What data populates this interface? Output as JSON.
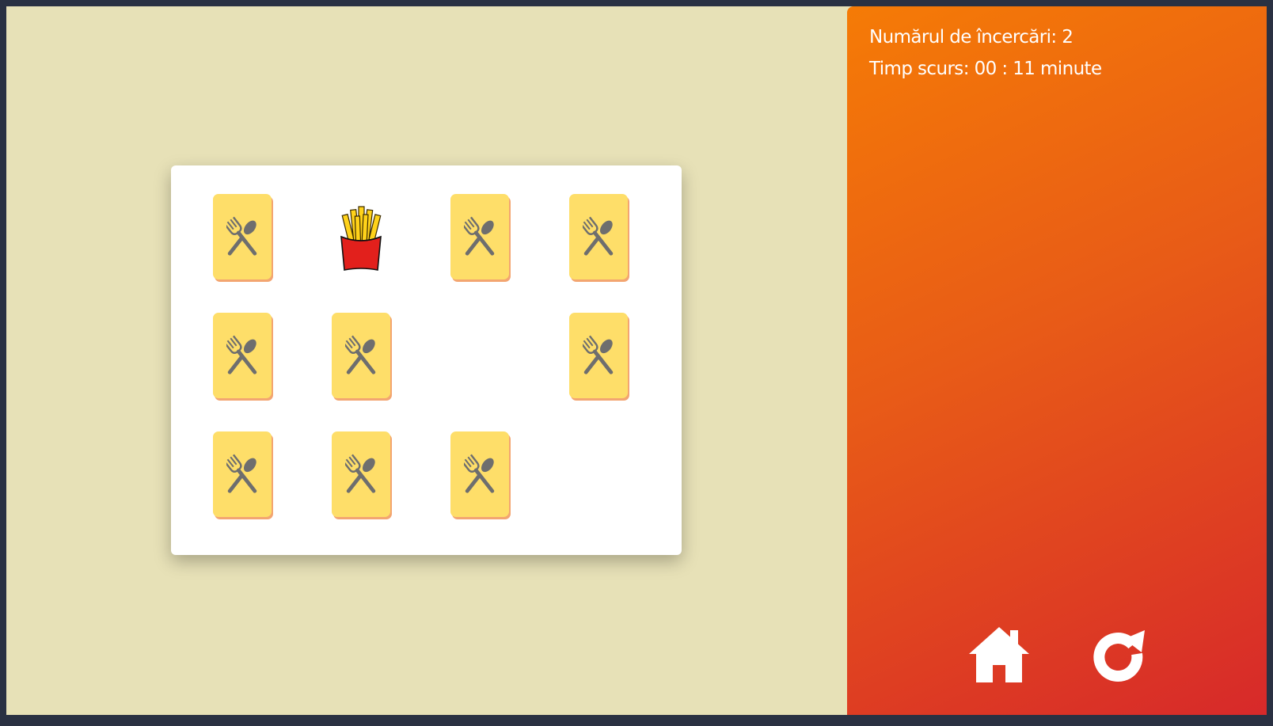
{
  "status": {
    "tries_label": "Numărul de încercări:",
    "tries_value": "2",
    "time_label": "Timp scurs:",
    "time_value": "00 : 11",
    "time_unit": "minute"
  },
  "board": {
    "rows": 3,
    "cols": 4,
    "cards": [
      {
        "row": 1,
        "col": 1,
        "state": "hidden",
        "face": "fork-spoon-icon"
      },
      {
        "row": 1,
        "col": 2,
        "state": "revealed",
        "face": "french-fries-icon"
      },
      {
        "row": 1,
        "col": 3,
        "state": "hidden",
        "face": "fork-spoon-icon"
      },
      {
        "row": 1,
        "col": 4,
        "state": "hidden",
        "face": "fork-spoon-icon"
      },
      {
        "row": 2,
        "col": 1,
        "state": "hidden",
        "face": "fork-spoon-icon"
      },
      {
        "row": 2,
        "col": 2,
        "state": "hidden",
        "face": "fork-spoon-icon"
      },
      {
        "row": 2,
        "col": 3,
        "state": "matched",
        "face": ""
      },
      {
        "row": 2,
        "col": 4,
        "state": "hidden",
        "face": "fork-spoon-icon"
      },
      {
        "row": 3,
        "col": 1,
        "state": "hidden",
        "face": "fork-spoon-icon"
      },
      {
        "row": 3,
        "col": 2,
        "state": "hidden",
        "face": "fork-spoon-icon"
      },
      {
        "row": 3,
        "col": 3,
        "state": "hidden",
        "face": "fork-spoon-icon"
      },
      {
        "row": 3,
        "col": 4,
        "state": "matched",
        "face": ""
      }
    ]
  },
  "controls": {
    "home_icon": "home-icon",
    "restart_icon": "restart-icon"
  },
  "colors": {
    "background": "#e7e1b7",
    "card_back": "#fede69",
    "card_shadow": "#f3a571",
    "panel_start": "#f57b06",
    "panel_end": "#d7292a"
  }
}
